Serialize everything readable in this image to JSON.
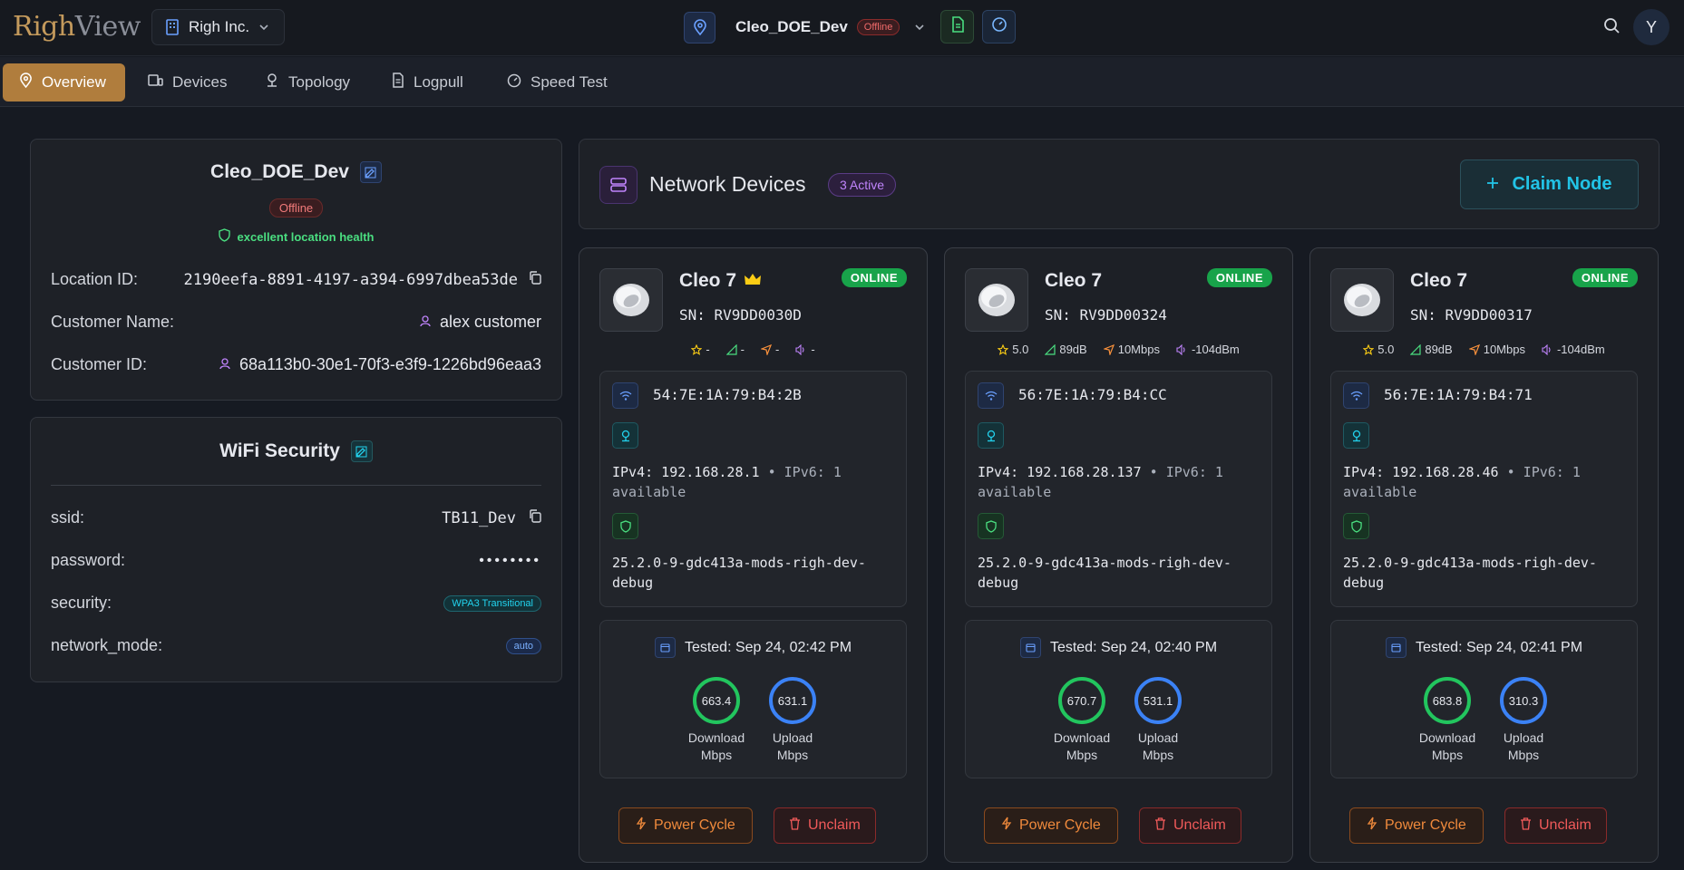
{
  "app": {
    "logo_a": "Righ",
    "logo_b": "View",
    "org": "Righ Inc.",
    "location": "Cleo_DOE_Dev",
    "location_status": "Offline",
    "avatar": "Y"
  },
  "tabs": [
    {
      "label": "Overview",
      "icon": "map-pin-icon"
    },
    {
      "label": "Devices",
      "icon": "devices-icon"
    },
    {
      "label": "Topology",
      "icon": "topology-icon"
    },
    {
      "label": "Logpull",
      "icon": "file-icon"
    },
    {
      "label": "Speed Test",
      "icon": "gauge-icon"
    }
  ],
  "location_panel": {
    "title": "Cleo_DOE_Dev",
    "status": "Offline",
    "health": "excellent location health",
    "location_id_label": "Location ID:",
    "location_id": "2190eefa-8891-4197-a394-6997dbea53de",
    "customer_name_label": "Customer Name:",
    "customer_name": "alex customer",
    "customer_id_label": "Customer ID:",
    "customer_id": "68a113b0-30e1-70f3-e3f9-1226bd96eaa3"
  },
  "wifi": {
    "title": "WiFi Security",
    "ssid_label": "ssid:",
    "ssid": "TB11_Dev",
    "password_label": "password:",
    "password": "••••••••",
    "security_label": "security:",
    "security": "WPA3 Transitional",
    "mode_label": "network_mode:",
    "mode": "auto"
  },
  "devices_header": {
    "title": "Network Devices",
    "badge": "3 Active",
    "claim": "Claim Node"
  },
  "devices": [
    {
      "name": "Cleo 7",
      "sn": "SN: RV9DD0030D",
      "status": "ONLINE",
      "crown": true,
      "rating": "-",
      "signal": "-",
      "rate": "-",
      "power": "-",
      "mac": "54:7E:1A:79:B4:2B",
      "ipv4": "IPv4: 192.168.28.1",
      "ipv6": " • IPv6: 1 available",
      "fw": "25.2.0-9-gdc413a-mods-righ-dev-debug",
      "tested": "Tested: Sep 24, 02:42 PM",
      "download": "663.4",
      "upload": "631.1"
    },
    {
      "name": "Cleo 7",
      "sn": "SN: RV9DD00324",
      "status": "ONLINE",
      "crown": false,
      "rating": "5.0",
      "signal": "89dB",
      "rate": "10Mbps",
      "power": "-104dBm",
      "mac": "56:7E:1A:79:B4:CC",
      "ipv4": "IPv4: 192.168.28.137",
      "ipv6": " • IPv6: 1 available",
      "fw": "25.2.0-9-gdc413a-mods-righ-dev-debug",
      "tested": "Tested: Sep 24, 02:40 PM",
      "download": "670.7",
      "upload": "531.1"
    },
    {
      "name": "Cleo 7",
      "sn": "SN: RV9DD00317",
      "status": "ONLINE",
      "crown": false,
      "rating": "5.0",
      "signal": "89dB",
      "rate": "10Mbps",
      "power": "-104dBm",
      "mac": "56:7E:1A:79:B4:71",
      "ipv4": "IPv4: 192.168.28.46",
      "ipv6": " • IPv6: 1 available",
      "fw": "25.2.0-9-gdc413a-mods-righ-dev-debug",
      "tested": "Tested: Sep 24, 02:41 PM",
      "download": "683.8",
      "upload": "310.3"
    }
  ],
  "labels": {
    "download": "Download",
    "upload": "Upload",
    "unit": "Mbps",
    "power_cycle": "Power Cycle",
    "unclaim": "Unclaim"
  },
  "colors": {
    "accent": "#b07d3d",
    "online": "#18a34a",
    "download_ring": "#22c55e",
    "upload_ring": "#3b82f6",
    "danger": "#f05a5a",
    "warn": "#f08a3c"
  }
}
